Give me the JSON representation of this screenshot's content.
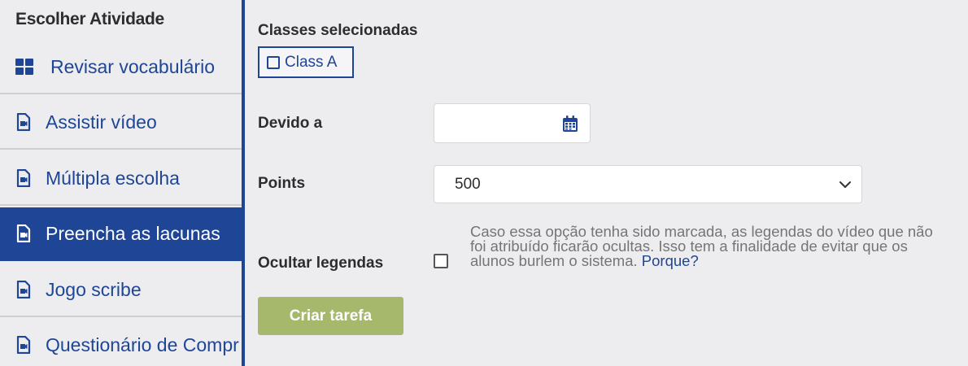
{
  "sidebar": {
    "heading": "Escolher Atividade",
    "items": [
      {
        "label": "Revisar vocabulário",
        "icon": "grid-icon",
        "active": false
      },
      {
        "label": "Assistir vídeo",
        "icon": "video-file-icon",
        "active": false
      },
      {
        "label": "Múltipla escolha",
        "icon": "video-file-icon",
        "active": false
      },
      {
        "label": "Preencha as lacunas",
        "icon": "video-file-icon",
        "active": true
      },
      {
        "label": "Jogo scribe",
        "icon": "video-file-icon",
        "active": false
      },
      {
        "label": "Questionário de Compr",
        "icon": "video-file-icon",
        "active": false
      }
    ]
  },
  "form": {
    "classes_label": "Classes selecionadas",
    "class_chip": "Class A",
    "due_label": "Devido a",
    "due_value": "",
    "points_label": "Points",
    "points_value": "500",
    "hide_subtitles_label": "Ocultar legendas",
    "hide_subtitles_checked": false,
    "help_text": "Caso essa opção tenha sido marcada, as legendas do vídeo que não foi atribuído ficarão ocultas. Isso tem a finalidade de evitar que os alunos burlem o sistema.",
    "help_link": "Porque?",
    "submit_label": "Criar tarefa"
  },
  "colors": {
    "primary": "#1f4596",
    "submit": "#a5b86c",
    "background": "#ededef"
  }
}
